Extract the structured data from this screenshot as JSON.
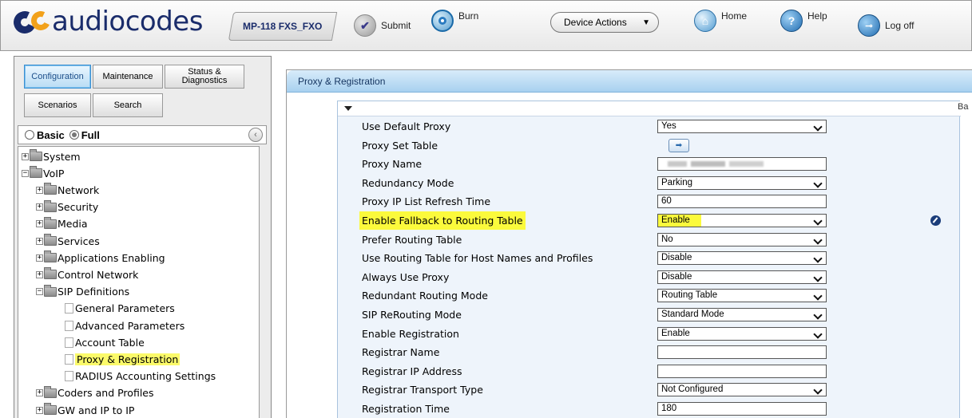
{
  "header": {
    "logo_text": "audiocodes",
    "device_name": "MP-118 FXS_FXO",
    "submit_label": "Submit",
    "burn_label": "Burn",
    "device_actions_label": "Device Actions",
    "home_label": "Home",
    "help_label": "Help",
    "logoff_label": "Log off"
  },
  "nav_tabs": {
    "configuration": "Configuration",
    "maintenance": "Maintenance",
    "status_diag": "Status & Diagnostics",
    "scenarios": "Scenarios",
    "search": "Search"
  },
  "view_mode": {
    "basic": "Basic",
    "full": "Full",
    "selected": "Full"
  },
  "tree": [
    {
      "label": "System",
      "level": 0,
      "type": "folder",
      "state": "collapsed"
    },
    {
      "label": "VoIP",
      "level": 0,
      "type": "folder",
      "state": "expanded"
    },
    {
      "label": "Network",
      "level": 1,
      "type": "folder",
      "state": "collapsed"
    },
    {
      "label": "Security",
      "level": 1,
      "type": "folder",
      "state": "collapsed"
    },
    {
      "label": "Media",
      "level": 1,
      "type": "folder",
      "state": "collapsed"
    },
    {
      "label": "Services",
      "level": 1,
      "type": "folder",
      "state": "collapsed"
    },
    {
      "label": "Applications Enabling",
      "level": 1,
      "type": "folder",
      "state": "collapsed"
    },
    {
      "label": "Control Network",
      "level": 1,
      "type": "folder",
      "state": "collapsed"
    },
    {
      "label": "SIP Definitions",
      "level": 1,
      "type": "folder",
      "state": "expanded"
    },
    {
      "label": "General Parameters",
      "level": 2,
      "type": "page"
    },
    {
      "label": "Advanced Parameters",
      "level": 2,
      "type": "page"
    },
    {
      "label": "Account Table",
      "level": 2,
      "type": "page"
    },
    {
      "label": "Proxy & Registration",
      "level": 2,
      "type": "page",
      "selected": true
    },
    {
      "label": "RADIUS Accounting Settings",
      "level": 2,
      "type": "page"
    },
    {
      "label": "Coders and Profiles",
      "level": 1,
      "type": "folder",
      "state": "collapsed"
    },
    {
      "label": "GW and IP to IP",
      "level": 1,
      "type": "folder",
      "state": "collapsed"
    }
  ],
  "panel": {
    "title": "Proxy & Registration",
    "cut_label": "Ba"
  },
  "params": [
    {
      "label": "Use Default Proxy",
      "kind": "select",
      "value": "Yes"
    },
    {
      "label": "Proxy Set Table",
      "kind": "table-button",
      "value": ""
    },
    {
      "label": "Proxy Name",
      "kind": "text-redacted",
      "value": ""
    },
    {
      "label": "Redundancy Mode",
      "kind": "select",
      "value": "Parking"
    },
    {
      "label": "Proxy IP List Refresh Time",
      "kind": "text",
      "value": "60"
    },
    {
      "label": "Enable Fallback to Routing Table",
      "kind": "select",
      "value": "Enable",
      "highlighted": true,
      "edited": true
    },
    {
      "label": "Prefer Routing Table",
      "kind": "select",
      "value": "No"
    },
    {
      "label": "Use Routing Table for Host Names and Profiles",
      "kind": "select",
      "value": "Disable"
    },
    {
      "label": "Always Use Proxy",
      "kind": "select",
      "value": "Disable"
    },
    {
      "label": "Redundant Routing Mode",
      "kind": "select",
      "value": "Routing Table"
    },
    {
      "label": "SIP ReRouting Mode",
      "kind": "select",
      "value": "Standard Mode"
    },
    {
      "label": "Enable Registration",
      "kind": "select",
      "value": "Enable"
    },
    {
      "label": "Registrar Name",
      "kind": "text",
      "value": ""
    },
    {
      "label": "Registrar IP Address",
      "kind": "text",
      "value": ""
    },
    {
      "label": "Registrar Transport Type",
      "kind": "select",
      "value": "Not Configured"
    },
    {
      "label": "Registration Time",
      "kind": "text",
      "value": "180"
    }
  ],
  "colors": {
    "brand_navy": "#1a2c6b",
    "brand_orange": "#f2a11a",
    "highlight_yellow": "#fbfa3c",
    "panel_header": "#a8d1ef"
  }
}
